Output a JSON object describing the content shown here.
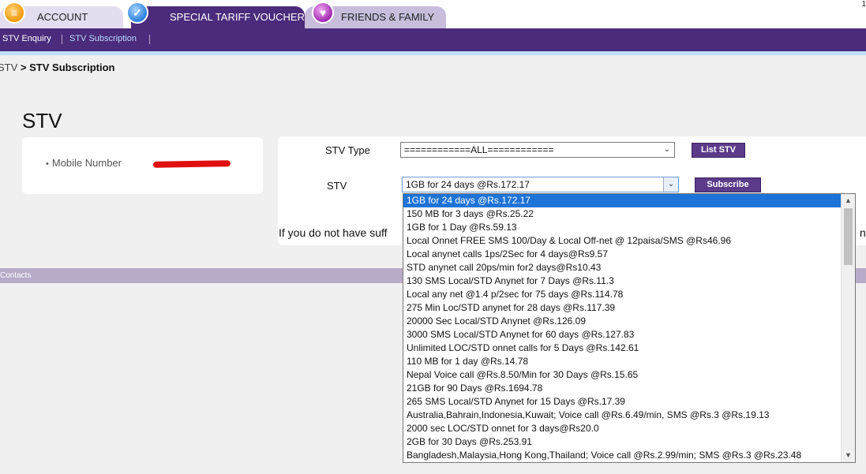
{
  "tabs": [
    {
      "label": "ACCOUNT",
      "icon": "account-icon"
    },
    {
      "label": "SPECIAL TARIFF VOUCHER",
      "icon": "voucher-icon"
    },
    {
      "label": "FRIENDS & FAMILY",
      "icon": "friends-family-icon"
    }
  ],
  "corner_mark": "1",
  "subnav": [
    "STV Enquiry",
    "STV Subscription"
  ],
  "breadcrumb": {
    "root": "STV",
    "separator": ">",
    "current": "STV Subscription"
  },
  "page_title": "STV",
  "mobile": {
    "label": "Mobile Number"
  },
  "form": {
    "stv_type_label": "STV Type",
    "stv_type_value": "============ALL============",
    "list_button": "List STV",
    "stv_label": "STV",
    "stv_value": "1GB for 24 days @Rs.172.17",
    "subscribe_button": "Subscribe",
    "info_text": "If you do not have suff",
    "info_tail": "nk"
  },
  "footer": {
    "label": "Contacts"
  },
  "dropdown": {
    "selected_index": 0,
    "options": [
      "1GB for 24 days @Rs.172.17",
      "150 MB for 3 days @Rs.25.22",
      "1GB for 1 Day @Rs.59.13",
      "Local Onnet FREE SMS 100/Day & Local Off-net @ 12paisa/SMS @Rs46.96",
      "Local anynet calls 1ps/2Sec for 4 days@Rs9.57",
      "STD anynet call 20ps/min for2 days@Rs10.43",
      "130 SMS Local/STD Anynet for 7 Days @Rs.11.3",
      "Local any net @1.4 p/2sec for 75 days @Rs.114.78",
      "275 Min Loc/STD anynet for 28 days @Rs.117.39",
      "20000 Sec Local/STD Anynet @Rs.126.09",
      "3000 SMS Local/STD Anynet for 60 days @Rs.127.83",
      "Unlimited LOC/STD onnet calls for 5 Days @Rs.142.61",
      "110 MB for 1 day @Rs.14.78",
      "Nepal Voice call @Rs.8.50/Min for 30 Days @Rs.15.65",
      "21GB for 90 Days @Rs.1694.78",
      "265 SMS Local/STD Anynet for 15 Days @Rs.17.39",
      "Australia,Bahrain,Indonesia,Kuwait; Voice call @Rs.6.49/min, SMS @Rs.3 @Rs.19.13",
      "2000 sec LOC/STD onnet for 3 days@Rs20.0",
      "2GB for 30 Days @Rs.253.91",
      "Bangladesh,Malaysia,Hong Kong,Thailand; Voice call @Rs.2.99/min; SMS @Rs.3 @Rs.23.48"
    ]
  }
}
